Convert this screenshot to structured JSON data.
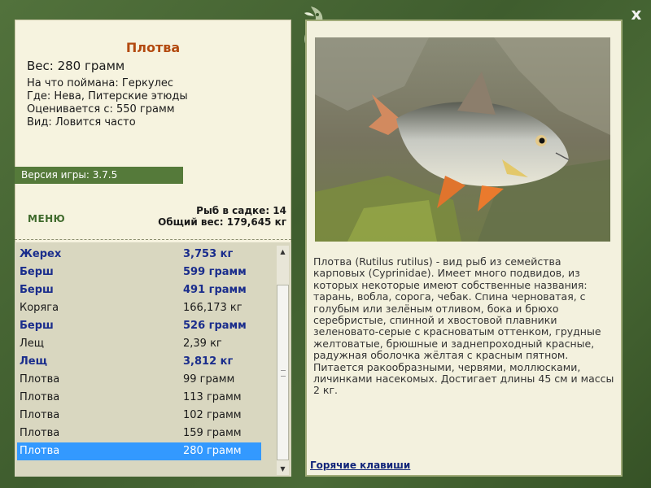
{
  "fish": {
    "title": "Плотва",
    "weight": "Вес: 280 грамм",
    "caught_on": "На что поймана: Геркулес",
    "location": "Где: Нева, Питерские этюды",
    "value": "Оценивается с: 550 грамм",
    "species_rate": "Вид: Ловится часто"
  },
  "version": "Версия игры: 3.7.5",
  "menu_label": "МЕНЮ",
  "stats": {
    "count": "Рыб в садке: 14",
    "total": "Общий вес: 179,645 кг"
  },
  "catch_list": [
    {
      "name": "Жерех",
      "weight": "3,753 кг",
      "bold": true
    },
    {
      "name": "Берш",
      "weight": "599 грамм",
      "bold": true
    },
    {
      "name": "Берш",
      "weight": "491 грамм",
      "bold": true
    },
    {
      "name": "Коряга",
      "weight": "166,173 кг",
      "bold": false
    },
    {
      "name": "Берш",
      "weight": "526 грамм",
      "bold": true
    },
    {
      "name": "Лещ",
      "weight": "2,39 кг",
      "bold": false
    },
    {
      "name": "Лещ",
      "weight": "3,812 кг",
      "bold": true
    },
    {
      "name": "Плотва",
      "weight": "99 грамм",
      "bold": false
    },
    {
      "name": "Плотва",
      "weight": "113 грамм",
      "bold": false
    },
    {
      "name": "Плотва",
      "weight": "102 грамм",
      "bold": false
    },
    {
      "name": "Плотва",
      "weight": "159 грамм",
      "bold": false
    },
    {
      "name": "Плотва",
      "weight": "280 грамм",
      "bold": false,
      "selected": true
    }
  ],
  "description": "Плотва (Rutilus rutilus) - вид рыб из семейства карповых (Cyprinidae). Имеет много подвидов, из которых некоторые имеют собственные названия: тарань, вобла, сорога, чебак. Спина черноватая, с голубым или зелёным отливом, бока и брюхо серебристые, спинной и хвостовой плавники зеленовато-серые с красноватым оттенком, грудные желтоватые, брюшные и заднепроходный красные, радужная оболочка жёлтая с красным пятном. Питается ракообразными, червями, моллюсками, личинками насекомых. Достигает длины 45 см и массы 2 кг.",
  "hotkeys_label": "Горячие клавиши",
  "close_label": "x",
  "icons": {
    "logo": "fish-logo-icon",
    "close": "close-icon",
    "scroll_up": "scroll-up-icon",
    "scroll_down": "scroll-down-icon"
  },
  "colors": {
    "frame": "#4a6a36",
    "title": "#b34a10",
    "version_bar": "#557a3a",
    "selection": "#3399ff",
    "bold_row": "#1a2d8c",
    "link": "#12267a"
  }
}
